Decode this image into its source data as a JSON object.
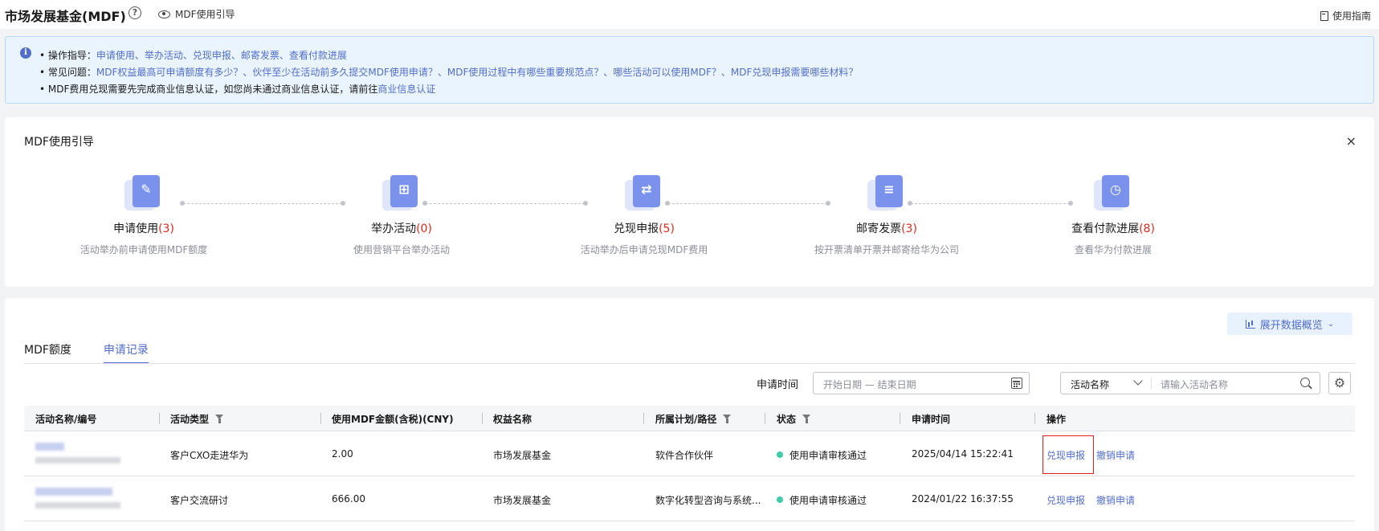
{
  "header": {
    "title": "市场发展基金(MDF)",
    "guide_link": "MDF使用引导",
    "manual": "使用指南"
  },
  "notice": {
    "line1_prefix": "• 操作指导：",
    "line1_links": "申请使用、举办活动、兑现申报、邮寄发票、查看付款进展",
    "line2_prefix": "• 常见问题：",
    "line2_links": "MDF权益最高可申请额度有多少？、伙伴至少在活动前多久提交MDF使用申请？、MDF使用过程中有哪些重要规范点？、哪些活动可以使用MDF？、MDF兑现申报需要哪些材料？",
    "line3_text": "• MDF费用兑现需要先完成商业信息认证，如您尚未通过商业信息认证，请前往",
    "line3_link": "商业信息认证"
  },
  "guide": {
    "title": "MDF使用引导",
    "close": "×",
    "steps": [
      {
        "name": "申请使用",
        "count": "(3)",
        "desc": "活动举办前申请使用MDF额度",
        "icon": "apply-doc-icon"
      },
      {
        "name": "举办活动",
        "count": "(0)",
        "desc": "使用营销平台举办活动",
        "icon": "activity-icon"
      },
      {
        "name": "兑现申报",
        "count": "(5)",
        "desc": "活动举办后申请兑现MDF费用",
        "icon": "exchange-icon"
      },
      {
        "name": "邮寄发票",
        "count": "(3)",
        "desc": "按开票清单开票并邮寄给华为公司",
        "icon": "invoice-icon"
      },
      {
        "name": "查看付款进展",
        "count": "(8)",
        "desc": "查看华为付款进展",
        "icon": "payment-clock-icon"
      }
    ]
  },
  "data": {
    "expand_btn": "展开数据概览",
    "tabs": [
      {
        "label": "MDF额度"
      },
      {
        "label": "申请记录"
      }
    ],
    "filter": {
      "date_label": "申请时间",
      "date_placeholder": "开始日期 — 结束日期",
      "search_select": "活动名称",
      "search_placeholder": "请输入活动名称"
    },
    "columns": [
      "活动名称/编号",
      "活动类型",
      "使用MDF金额(含税)(CNY)",
      "权益名称",
      "所属计划/路径",
      "状态",
      "申请时间",
      "操作"
    ],
    "rows": [
      {
        "type": "客户CXO走进华为",
        "amount": "2.00",
        "benefit": "市场发展基金",
        "plan": "软件合作伙伴",
        "status": "使用申请审核通过",
        "time": "2025/04/14 15:22:41",
        "action1": "兑现申报",
        "action2": "撤销申请"
      },
      {
        "type": "客户交流研讨",
        "amount": "666.00",
        "benefit": "市场发展基金",
        "plan": "数字化转型咨询与系统...",
        "status": "使用申请审核通过",
        "time": "2024/01/22 16:37:55",
        "action1": "兑现申报",
        "action2": "撤销申请"
      }
    ]
  },
  "colors": {
    "accent": "#526ecc",
    "count_red": "#e0281e",
    "status_green": "#3dcca6",
    "highlight_red": "#e02020"
  }
}
